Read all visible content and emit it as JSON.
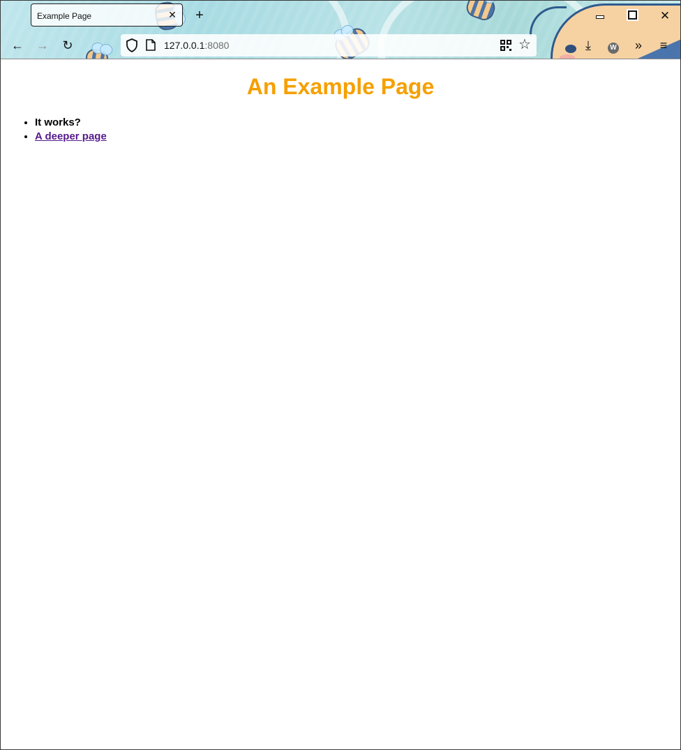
{
  "browser": {
    "tab": {
      "title": "Example Page",
      "close_glyph": "✕"
    },
    "new_tab_glyph": "+",
    "window_controls": {
      "minimize": "minimize-icon",
      "maximize": "maximize-icon",
      "close_glyph": "✕"
    },
    "toolbar": {
      "back_glyph": "←",
      "forward_glyph": "→",
      "reload_glyph": "↻",
      "url_host": "127.0.0.1",
      "url_port": ":8080",
      "star_glyph": "☆",
      "download_glyph": "⤓",
      "extension_letter": "W",
      "overflow_glyph": "»",
      "menu_glyph": "≡"
    }
  },
  "page": {
    "heading": "An Example Page",
    "items": [
      {
        "text": "It works?"
      },
      {
        "text": "A deeper page"
      }
    ],
    "heading_color": "#f5a000",
    "link_color": "#551a8b"
  }
}
